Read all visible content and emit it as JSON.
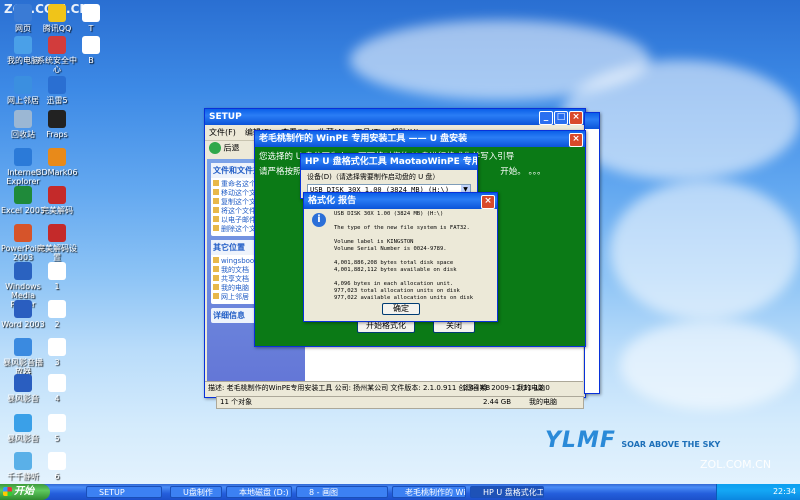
{
  "watermarks": {
    "top": "ZOL.COM.CN",
    "bottom": "ZOL.COM.CN"
  },
  "desktop_icons": [
    {
      "label": "网页",
      "color": "#3a7bd5"
    },
    {
      "label": "腾讯QQ",
      "color": "#f0c419"
    },
    {
      "label": "T",
      "color": "#ffffff"
    },
    {
      "label": "我的电脑",
      "color": "#4aa0e8"
    },
    {
      "label": "系统安全中心",
      "color": "#d23c3c"
    },
    {
      "label": "B",
      "color": "#ffffff"
    },
    {
      "label": "网上邻居",
      "color": "#3b8fe0"
    },
    {
      "label": "迅雷5",
      "color": "#2a6fd2"
    },
    {
      "label": "回收站",
      "color": "#9bb7d4"
    },
    {
      "label": "Fraps",
      "color": "#222222"
    },
    {
      "label": "Internet Explorer",
      "color": "#2b7ad8"
    },
    {
      "label": "3DMark06",
      "color": "#e88a1a"
    },
    {
      "label": "Excel 2003",
      "color": "#1f8a3a"
    },
    {
      "label": "完美解码",
      "color": "#c42a2a"
    },
    {
      "label": "PowerPoint 2003",
      "color": "#d6542a"
    },
    {
      "label": "完美解码设置",
      "color": "#c42a2a"
    },
    {
      "label": "Windows Media Player",
      "color": "#2a62c0"
    },
    {
      "label": "1",
      "color": "#ffffff"
    },
    {
      "label": "Word 2003",
      "color": "#2a5ec0"
    },
    {
      "label": "2",
      "color": "#ffffff"
    },
    {
      "label": "暴风影音播放器",
      "color": "#3a8ae0"
    },
    {
      "label": "3",
      "color": "#ffffff"
    },
    {
      "label": "暴风影音",
      "color": "#2a5ec0"
    },
    {
      "label": "4",
      "color": "#ffffff"
    },
    {
      "label": "暴风影音",
      "color": "#3aa0e8"
    },
    {
      "label": "5",
      "color": "#ffffff"
    },
    {
      "label": "千千静听",
      "color": "#5ab0e8"
    },
    {
      "label": "6",
      "color": "#ffffff"
    }
  ],
  "explorer": {
    "title": "SETUP",
    "menu": [
      "文件(F)",
      "编辑(E)",
      "查看(V)",
      "收藏(A)",
      "工具(T)",
      "帮助(H)"
    ],
    "back_label": "后退",
    "task_panel_title": "文件和文件夹任务",
    "task_items": [
      "重命名这个文件",
      "移动这个文件",
      "复制这个文件",
      "将这个文件发布到 Web",
      "以电子邮件形式发送此文件",
      "删除这个文件"
    ],
    "other_places_title": "其它位置",
    "other_places": [
      "wingsboot",
      "我的文档",
      "共享文档",
      "我的电脑",
      "网上邻居"
    ],
    "details_title": "详细信息",
    "status_desc": "描述: 老毛桃制作的WinPE专用安装工具  公司: 扬州某公司  文件版本: 2.1.0.911  创建日期: 2009-12-11 12:0",
    "status_size": "2.44 KB",
    "status_loc": "我的电脑",
    "items_count": "11 个对象",
    "status2_size": "2.44 GB",
    "status2_loc": "我的电脑"
  },
  "installer": {
    "title": "老毛桃制作的 WinPE 专用安装工具 —— U 盘安装",
    "line1": "您选择的 U 盘分区为 h:，下面将对您的 U 盘进行格式化并写入引导",
    "line2": "请严格按照相关工具",
    "line2_tail": "开始。",
    "dots": "。。。",
    "btn_start": "开始格式化",
    "btn_exit": "关闭"
  },
  "format_tool": {
    "title": "HP U 盘格式化工具 MaotaoWinPE 专用版",
    "device_label": "设备(D)（请选择需要制作启动盘的 U 盘）",
    "device_value": "USB DISK 30X 1.00 (3824 MB) (H:\\)"
  },
  "report": {
    "title": "格式化 报告",
    "lines": [
      "USB DISK 30X 1.00 (3824 MB) (H:\\)",
      "",
      "The type of the new file system is FAT32.",
      "",
      "Volume label is KINGSTON",
      "Volume Serial Number is 0024-9789.",
      "",
      "4,001,886,208 bytes total disk space",
      "4,001,882,112 bytes available on disk",
      "",
      "4,096 bytes in each allocation unit.",
      "977,023 total allocation units on disk",
      "977,022 available allocation units on disk"
    ],
    "ok_label": "确定"
  },
  "logo": {
    "brand": "YLMF",
    "tagline": "SOAR ABOVE THE SKY"
  },
  "taskbar": {
    "start_label": "开始",
    "items": [
      "SETUP",
      "U盘制作",
      "本地磁盘 (D:)",
      "8 - 画图",
      "老毛桃制作的 Win...",
      "HP U 盘格式化工..."
    ],
    "clock": "22:34"
  },
  "colors": {
    "installer_bg": "#0b7a16",
    "title_blue": "#0a5fe8"
  }
}
